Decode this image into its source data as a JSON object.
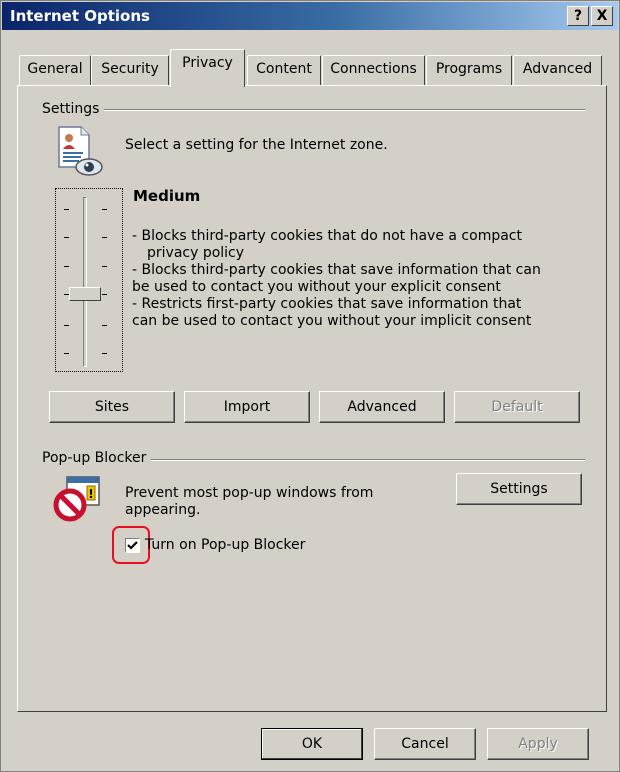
{
  "window": {
    "title": "Internet Options",
    "help_button": "?",
    "close_button": "X"
  },
  "tabs": [
    {
      "label": "General"
    },
    {
      "label": "Security"
    },
    {
      "label": "Privacy",
      "active": true
    },
    {
      "label": "Content"
    },
    {
      "label": "Connections"
    },
    {
      "label": "Programs"
    },
    {
      "label": "Advanced"
    }
  ],
  "settings": {
    "group_label": "Settings",
    "instruction": "Select a setting for the Internet zone.",
    "level_title": "Medium",
    "description_lines": [
      "- Blocks third-party cookies that do not have a compact",
      "privacy policy",
      "- Blocks third-party cookies that save information that can",
      "be used to contact you without your explicit consent",
      "- Restricts first-party cookies that save information that",
      "can be used to contact you without your implicit consent"
    ],
    "slider": {
      "levels": 6,
      "current_level": 3,
      "tick_mark": "-"
    },
    "buttons": {
      "sites": "Sites",
      "import": "Import",
      "advanced": "Advanced",
      "default": "Default"
    }
  },
  "popup": {
    "group_label": "Pop-up Blocker",
    "description_line1": "Prevent most pop-up windows from",
    "description_line2": "appearing.",
    "settings_button": "Settings",
    "checkbox_label": "Turn on Pop-up Blocker",
    "checkbox_checked": true
  },
  "footer": {
    "ok": "OK",
    "cancel": "Cancel",
    "apply": "Apply"
  },
  "colors": {
    "dialog_face": "#d4d0c8",
    "title_gradient_start": "#0a246a",
    "title_gradient_end": "#a6caf0",
    "highlight_ring": "#e8101c"
  }
}
